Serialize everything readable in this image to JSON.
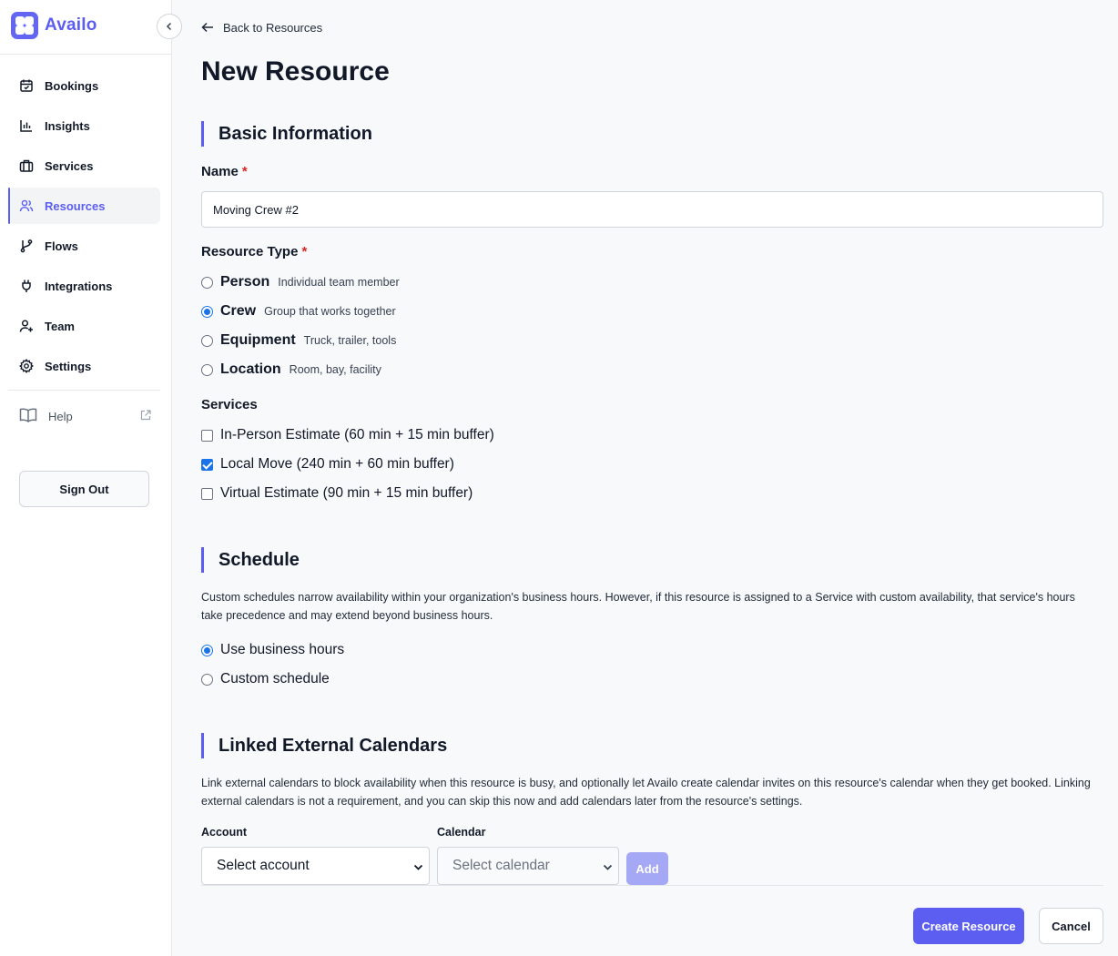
{
  "brand": {
    "name": "Availo",
    "accent": "#5b5ef0"
  },
  "sidebar": {
    "items": [
      {
        "label": "Bookings",
        "icon": "calendar-icon"
      },
      {
        "label": "Insights",
        "icon": "bar-chart-icon"
      },
      {
        "label": "Services",
        "icon": "briefcase-icon"
      },
      {
        "label": "Resources",
        "icon": "users-icon",
        "active": true
      },
      {
        "label": "Flows",
        "icon": "git-branch-icon"
      },
      {
        "label": "Integrations",
        "icon": "plug-icon"
      },
      {
        "label": "Team",
        "icon": "user-plus-icon"
      },
      {
        "label": "Settings",
        "icon": "gear-icon"
      }
    ],
    "help_label": "Help",
    "signout_label": "Sign Out"
  },
  "header": {
    "back_label": "Back to Resources",
    "title": "New Resource"
  },
  "basic": {
    "section_title": "Basic Information",
    "name_label": "Name",
    "name_value": "Moving Crew #2",
    "required_mark": "*",
    "type_label": "Resource Type",
    "types": [
      {
        "label": "Person",
        "desc": "Individual team member",
        "selected": false
      },
      {
        "label": "Crew",
        "desc": "Group that works together",
        "selected": true
      },
      {
        "label": "Equipment",
        "desc": "Truck, trailer, tools",
        "selected": false
      },
      {
        "label": "Location",
        "desc": "Room, bay, facility",
        "selected": false
      }
    ],
    "services_label": "Services",
    "services": [
      {
        "label": "In-Person Estimate (60 min + 15 min buffer)",
        "checked": false
      },
      {
        "label": "Local Move (240 min + 60 min buffer)",
        "checked": true
      },
      {
        "label": "Virtual Estimate (90 min + 15 min buffer)",
        "checked": false
      }
    ]
  },
  "schedule": {
    "section_title": "Schedule",
    "description": "Custom schedules narrow availability within your organization's business hours. However, if this resource is assigned to a Service with custom availability, that service's hours take precedence and may extend beyond business hours.",
    "options": [
      {
        "label": "Use business hours",
        "selected": true
      },
      {
        "label": "Custom schedule",
        "selected": false
      }
    ]
  },
  "calendars": {
    "section_title": "Linked External Calendars",
    "description": "Link external calendars to block availability when this resource is busy, and optionally let Availo create calendar invites on this resource's calendar when they get booked. Linking external calendars is not a requirement, and you can skip this now and add calendars later from the resource's settings.",
    "account_label": "Account",
    "account_value": "Select account",
    "calendar_label": "Calendar",
    "calendar_value": "Select calendar",
    "add_label": "Add"
  },
  "footer": {
    "create_label": "Create Resource",
    "cancel_label": "Cancel"
  }
}
